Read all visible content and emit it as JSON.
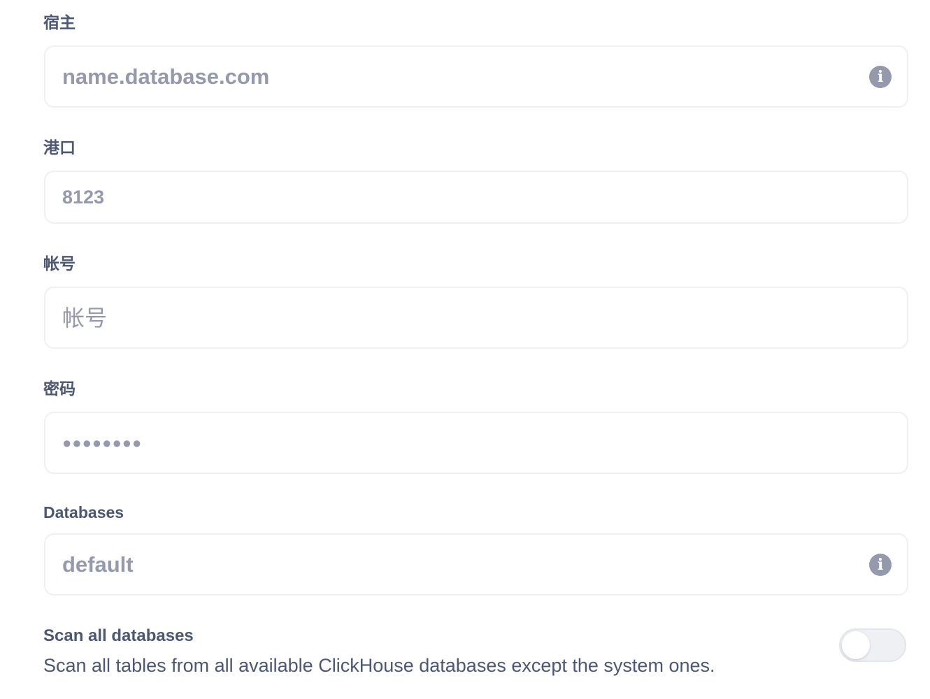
{
  "fields": {
    "host": {
      "label": "宿主",
      "placeholder": "name.database.com",
      "info_icon": "info-icon"
    },
    "port": {
      "label": "港口",
      "placeholder": "8123"
    },
    "username": {
      "label": "帐号",
      "placeholder": "帐号"
    },
    "password": {
      "label": "密码",
      "value": "●●●●●●●●"
    },
    "databases": {
      "label": "Databases",
      "placeholder": "default",
      "info_icon": "info-icon"
    }
  },
  "scan_all": {
    "title": "Scan all databases",
    "description": "Scan all tables from all available ClickHouse databases except the system ones.",
    "enabled": false
  },
  "colors": {
    "text": "#4c5773",
    "placeholder": "#949aab",
    "border": "#eef0f3",
    "toggle_off": "#eef0f3"
  }
}
